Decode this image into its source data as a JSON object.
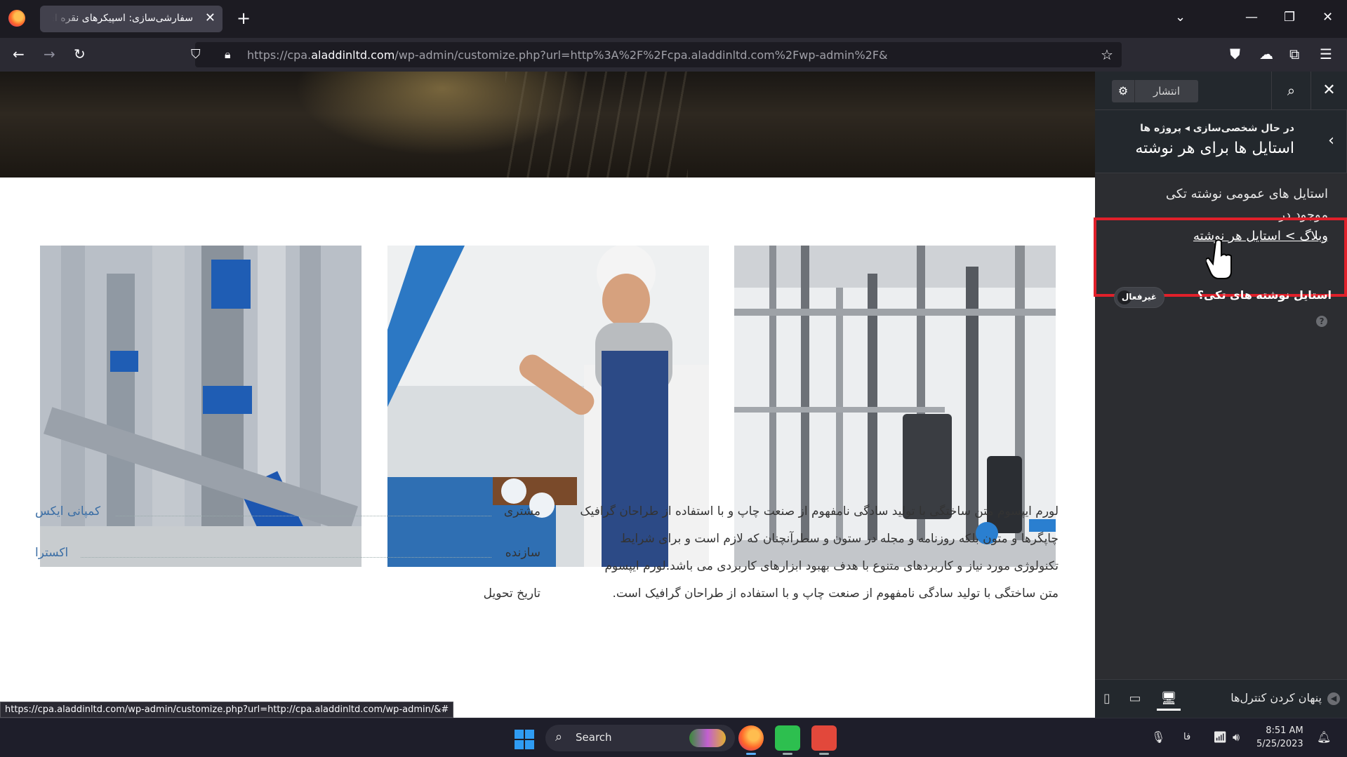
{
  "browser": {
    "tab_title": "سفارشی‌سازی: اسپیکرهای نقره ای ویژه",
    "tab_close": "✕",
    "new_tab": "+",
    "url_prefix": "https://cpa.",
    "url_domain": "aladdinltd.com",
    "url_suffix": "/wp-admin/customize.php?url=http%3A%2F%2Fcpa.aladdinltd.com%2Fwp-admin%2F&",
    "status_url": "https://cpa.aladdinltd.com/wp-admin/customize.php?url=http://cpa.aladdinltd.com/wp-admin/&#"
  },
  "content": {
    "body_lines": [
      "لورم ایپسوم متن ساختگی با تولید سادگی نامفهوم از صنعت چاپ و با استفاده از طراحان گرافیک",
      "چاپگرها و متون بلکه روزنامه و مجله در ستون و سطرآنچنان که لازم است و برای شرایط",
      "تکنولوژی مورد نیاز و کاربردهای متنوع با هدف بهبود ابزارهای کاربردی می باشد.لورم ایپسوم",
      "متن ساختگی با تولید سادگی نامفهوم از صنعت چاپ و با استفاده از طراحان گرافیک است."
    ],
    "meta": [
      {
        "label": "مشتری",
        "value": "کمپانی ایکس"
      },
      {
        "label": "سازنده",
        "value": "اکسترا"
      },
      {
        "label": "تاریخ تحویل",
        "value": ""
      }
    ]
  },
  "sidebar": {
    "publish_label": "انتشار",
    "breadcrumb": "در حال شخصی‌سازی ◂ پروژه ها",
    "title": "استایل ها برای هر نوشته",
    "description": "استایل های عمومی نوشته تکی موجود در",
    "description_link": "وبلاگ > استایل هر نوشته",
    "option_label": "استایل نوشته های تکی؟",
    "toggle_text": "غیرفعال",
    "help_icon": "?",
    "hide_controls": "پنهان کردن کنترل‌ها"
  },
  "taskbar": {
    "search_label": "Search",
    "lang": "فا",
    "time": "8:51 AM",
    "date": "5/25/2023"
  },
  "colors": {
    "highlight": "#e0202a",
    "link": "#3b6ea5",
    "sidebar_bg": "#2c2d31"
  }
}
